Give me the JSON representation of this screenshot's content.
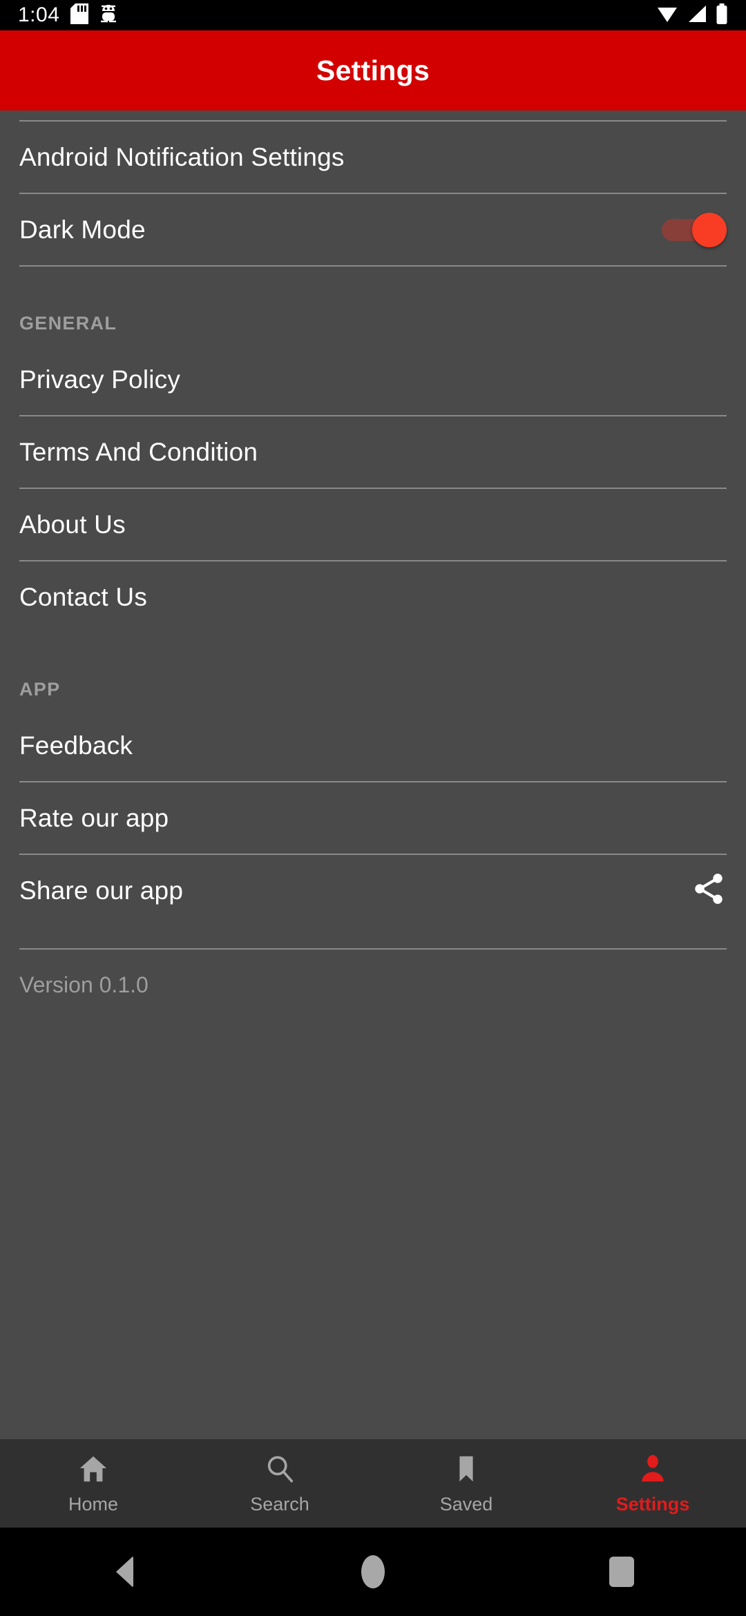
{
  "status_bar": {
    "time": "1:04",
    "left_icons": [
      "sd-card-icon",
      "android-debug-icon"
    ],
    "right_icons": [
      "wifi-icon",
      "cellular-signal-icon",
      "battery-icon"
    ],
    "background_color": "#000000"
  },
  "app_bar": {
    "title": "Settings",
    "background_color": "#D30000",
    "title_color": "#FFFFFF"
  },
  "theme": {
    "page_background": "#4A4A4A",
    "divider_color": "#8A8A8A",
    "primary_text": "#FFFFFF",
    "secondary_text": "#9E9E9E",
    "accent": "#E21B1B",
    "switch_thumb": "#F93D25",
    "bottom_nav_background": "#303030",
    "inactive_nav": "#A6A6A6"
  },
  "settings": {
    "top_items": [
      {
        "label": "Android Notification Settings",
        "type": "link"
      },
      {
        "label": "Dark Mode",
        "type": "switch",
        "value": "on"
      }
    ],
    "sections": [
      {
        "header": "GENERAL",
        "items": [
          {
            "label": "Privacy Policy",
            "type": "link"
          },
          {
            "label": "Terms And Condition",
            "type": "link"
          },
          {
            "label": "About Us",
            "type": "link"
          },
          {
            "label": "Contact Us",
            "type": "link"
          }
        ]
      },
      {
        "header": "APP",
        "items": [
          {
            "label": "Feedback",
            "type": "link"
          },
          {
            "label": "Rate our app",
            "type": "link"
          },
          {
            "label": "Share our app",
            "type": "link",
            "trailing_icon": "share-icon"
          }
        ]
      }
    ],
    "version": "Version 0.1.0"
  },
  "bottom_nav": {
    "items": [
      {
        "label": "Home",
        "icon": "home-icon",
        "active": false
      },
      {
        "label": "Search",
        "icon": "search-icon",
        "active": false
      },
      {
        "label": "Saved",
        "icon": "bookmark-icon",
        "active": false
      },
      {
        "label": "Settings",
        "icon": "person-icon",
        "active": true
      }
    ]
  },
  "system_nav": {
    "buttons": [
      "back-button",
      "home-button",
      "recents-button"
    ]
  }
}
